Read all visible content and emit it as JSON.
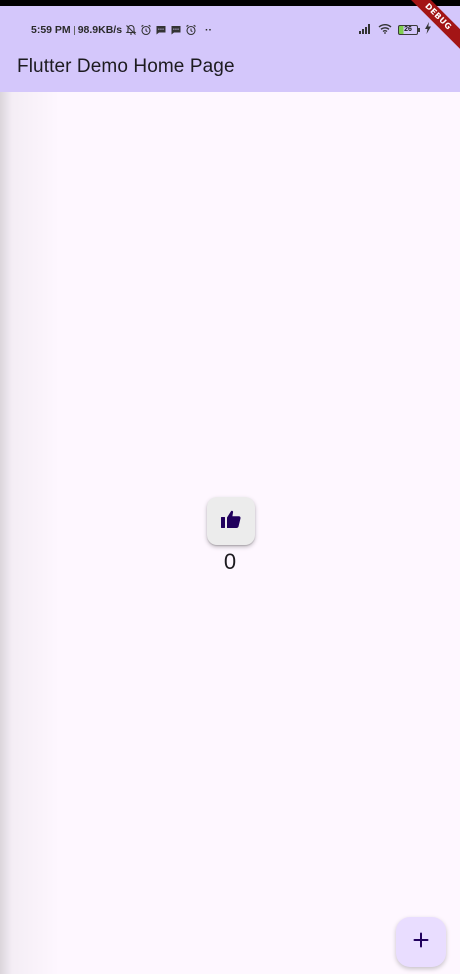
{
  "status_bar": {
    "time": "5:59 PM",
    "network_speed": "98.9KB/s",
    "left_icons": [
      "bell-off-icon",
      "alarm-icon",
      "message-icon",
      "message-icon",
      "alarm-icon"
    ],
    "overflow": "··",
    "right_icons": [
      "signal-icon",
      "wifi-icon",
      "battery-icon",
      "charging-icon"
    ],
    "battery_level": "26"
  },
  "app_bar": {
    "title": "Flutter Demo Home Page"
  },
  "debug_banner": {
    "label": "DEBUG"
  },
  "main": {
    "like_button_icon": "thumb-up-icon",
    "counter_value": "0"
  },
  "fab": {
    "icon": "plus-icon"
  },
  "colors": {
    "app_bar_bg": "#d4c7fb",
    "page_bg": "#fef7ff",
    "fab_bg": "#e9ddff",
    "debug_banner": "#a31515",
    "icon_dark": "#21005d"
  }
}
